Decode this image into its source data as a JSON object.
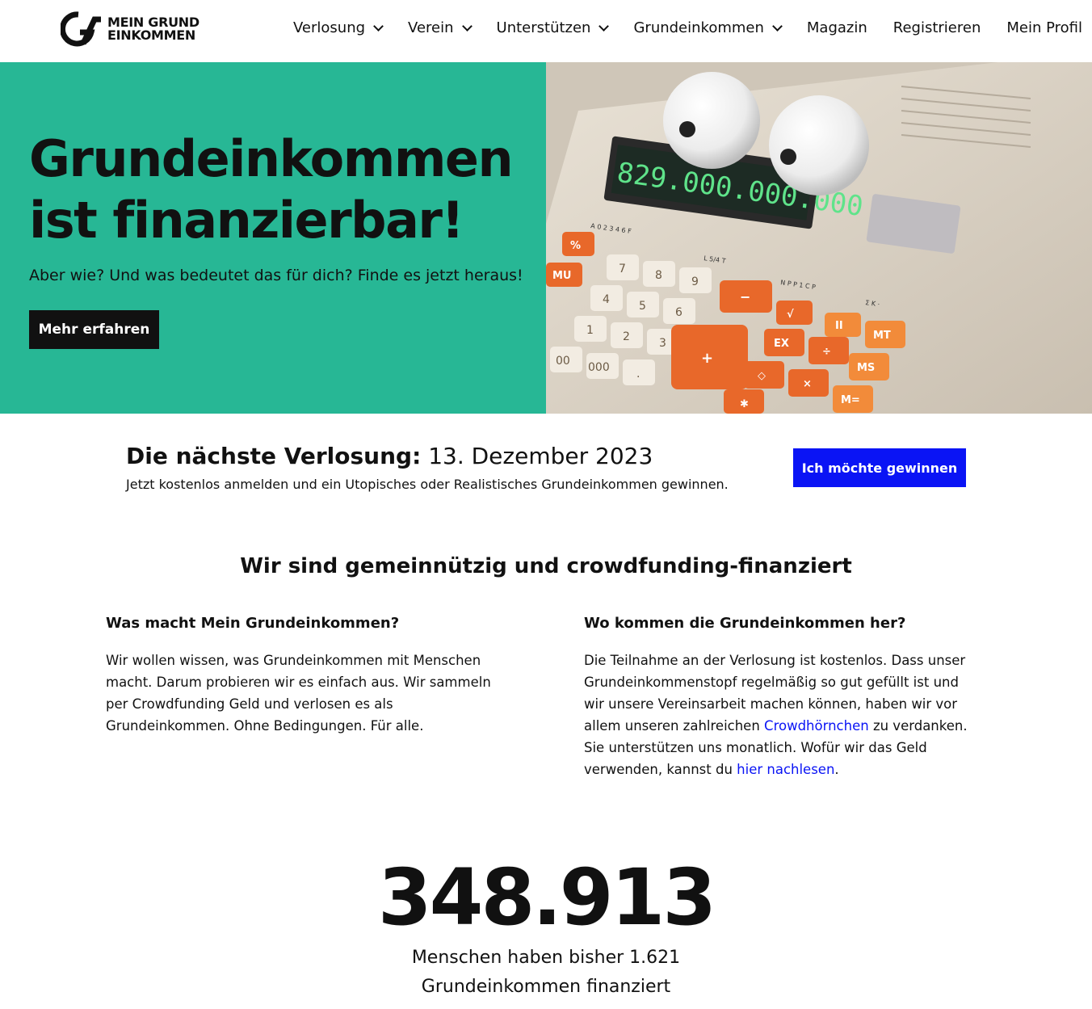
{
  "header": {
    "logo_line1": "MEIN GRUND",
    "logo_line2": "EINKOMMEN",
    "nav": [
      {
        "label": "Verlosung",
        "has_dropdown": true
      },
      {
        "label": "Verein",
        "has_dropdown": true
      },
      {
        "label": "Unterstützen",
        "has_dropdown": true
      },
      {
        "label": "Grundeinkommen",
        "has_dropdown": true
      },
      {
        "label": "Magazin",
        "has_dropdown": false
      },
      {
        "label": "Registrieren",
        "has_dropdown": false
      },
      {
        "label": "Mein Profil",
        "has_dropdown": false
      }
    ]
  },
  "hero": {
    "title_line1": "Grundeinkommen",
    "title_line2": "ist finanzierbar!",
    "subtitle": "Aber wie? Und was bedeutet das für dich? Finde es jetzt heraus!",
    "button_label": "Mehr erfahren",
    "background_color": "#27b795",
    "image": {
      "display_text": "829.000.000.000",
      "keys": [
        "7",
        "8",
        "9",
        "4",
        "5",
        "6",
        "1",
        "2",
        "3",
        "00",
        "000",
        ".",
        "+",
        "−",
        "%",
        "MU",
        "EX",
        "÷",
        "×",
        "◇",
        "MS",
        "M=",
        "MT",
        "II",
        "✱",
        "√"
      ],
      "switch_labels": [
        "A 0 2 3 4 6 F",
        "L 5/4 T",
        "N P P 1 C P",
        "Σ K ·"
      ]
    }
  },
  "lottery": {
    "title_bold": "Die nächste Verlosung:",
    "title_date": "13. Dezember 2023",
    "subtitle": "Jetzt kostenlos anmelden und ein Utopisches oder Realistisches Grundeinkommen gewinnen.",
    "button_label": "Ich möchte gewinnen",
    "button_color": "#0a14f5"
  },
  "info": {
    "title": "Wir sind gemeinnützig und crowdfunding-finanziert",
    "left": {
      "heading": "Was macht Mein Grundeinkommen?",
      "text": "Wir wollen wissen, was Grundeinkommen mit Menschen macht. Darum probieren wir es einfach aus. Wir sammeln per Crowdfunding Geld und verlosen es als Grundeinkommen. Ohne Bedingungen. Für alle."
    },
    "right": {
      "heading": "Wo kommen die Grundeinkommen her?",
      "text_before_link1": "Die Teilnahme an der Verlosung ist kostenlos. Dass unser Grundeinkommenstopf regelmäßig so gut gefüllt ist und wir unsere Vereinsarbeit machen können, haben wir vor allem unseren zahlreichen ",
      "link1": "Crowdhörnchen",
      "text_between": " zu verdanken. Sie unterstützen uns monatlich. Wofür wir das Geld verwenden, kannst du ",
      "link2": "hier nachlesen",
      "text_after": ".",
      "link_color": "#0a14f5"
    }
  },
  "stats": {
    "number": "348.913",
    "line1": "Menschen haben bisher 1.621",
    "line2": "Grundeinkommen finanziert"
  }
}
